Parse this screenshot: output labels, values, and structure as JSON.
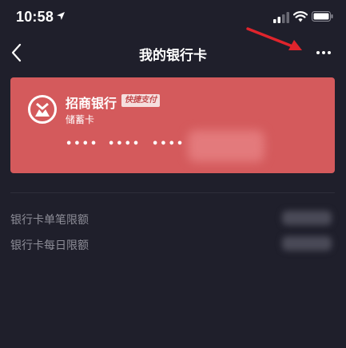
{
  "status_bar": {
    "time": "10:58",
    "icons": [
      "location-arrow-icon",
      "signal-icon",
      "wifi-icon",
      "battery-icon"
    ]
  },
  "nav": {
    "title": "我的银行卡",
    "back_icon": "chevron-left-icon",
    "more_icon": "more-dots-icon"
  },
  "annotation": {
    "type": "red-arrow-pointing-to-more-button",
    "color": "#e0242c"
  },
  "card": {
    "bank_name": "招商银行",
    "badge": "快捷支付",
    "card_type": "储蓄卡",
    "mask_groups": [
      "••••",
      "••••",
      "••••"
    ],
    "card_color": "#d45a5c",
    "logo_icon": "cmb-bank-logo-icon"
  },
  "limits": [
    {
      "label": "银行卡单笔限额"
    },
    {
      "label": "银行卡每日限额"
    }
  ],
  "colors": {
    "background": "#1f1f2b",
    "label_gray": "#8e8e98"
  }
}
